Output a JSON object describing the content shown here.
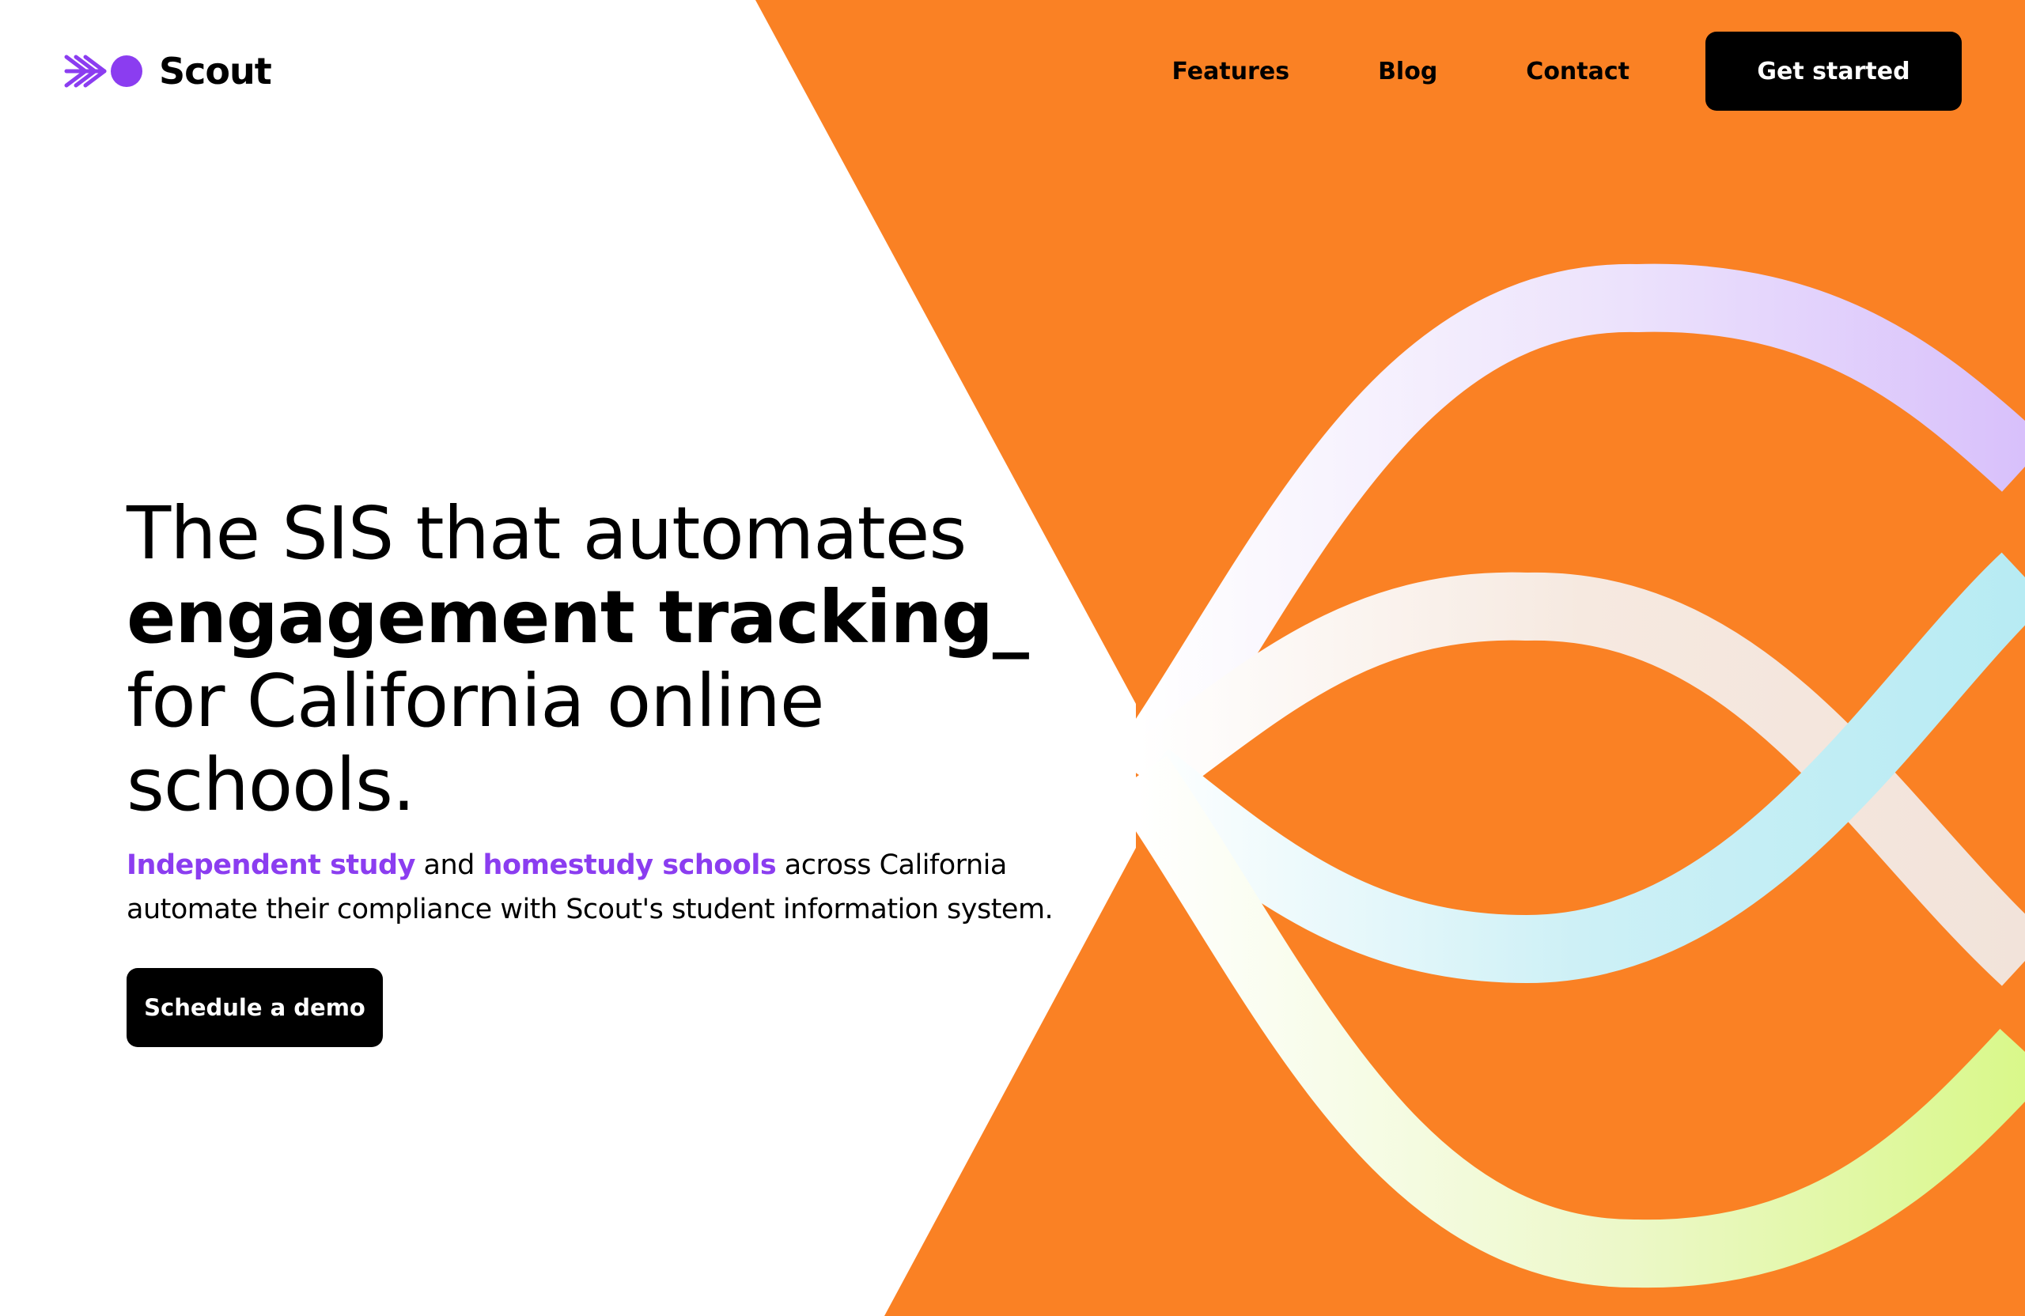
{
  "brand": {
    "name": "Scout",
    "logo_icon": "scout-logo-icon",
    "accent_color": "#8b3df0"
  },
  "nav": {
    "links": [
      "Features",
      "Blog",
      "Contact"
    ],
    "cta_label": "Get started"
  },
  "hero": {
    "headline_line1": "The SIS that automates",
    "headline_bold": "engagement tracking",
    "headline_cursor": "_",
    "headline_line3": "for California online",
    "headline_line4": "schools.",
    "sub_link1": "Independent study",
    "sub_and": " and ",
    "sub_link2": "homestudy schools",
    "sub_rest1": " across California",
    "sub_line2": "automate their compliance with Scout's student information system.",
    "cta_label": "Schedule a demo"
  },
  "colors": {
    "background": "#ffffff",
    "art_orange": "#fa8124",
    "button": "#000000",
    "button_text": "#ffffff",
    "accent": "#8b3df0"
  }
}
